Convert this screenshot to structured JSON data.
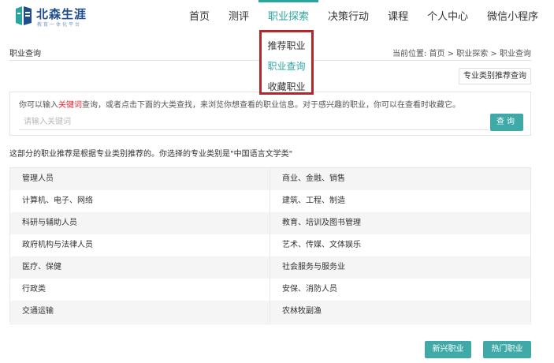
{
  "brand": {
    "name": "北森生涯",
    "tagline": "教育一体化平台",
    "colors": {
      "primary": "#2aa6a0",
      "button": "#3ea9a6",
      "highlight": "#b3262a",
      "keyword": "#e3262e",
      "logo": "#1f4e8a"
    }
  },
  "nav": {
    "items": [
      {
        "label": "首页"
      },
      {
        "label": "测评"
      },
      {
        "label": "职业探索"
      },
      {
        "label": "决策行动"
      },
      {
        "label": "课程"
      },
      {
        "label": "个人中心"
      },
      {
        "label": "微信小程序"
      }
    ],
    "active": "职业探索"
  },
  "dropdown": {
    "items": [
      {
        "label": "推荐职业"
      },
      {
        "label": "职业查询"
      },
      {
        "label": "收藏职业"
      }
    ]
  },
  "page": {
    "label": "职业查询",
    "breadcrumb": "当前位置:   首页 > 职业探索 > 职业查询",
    "recommend_button": "专业类别推荐查询"
  },
  "search": {
    "hint_before": "你可以输入",
    "hint_keyword": "关键词",
    "hint_after": "查询，或者点击下面的大类查找，来浏览你想查看的职业信息。对于感兴趣的职业，你可以在查看时收藏它。",
    "placeholder": "请输入关键词",
    "button": "查询"
  },
  "intro": "这部分的职业推荐是根据专业类别推荐的。你选择的专业类别是\"中国语言文学类\"",
  "categories": [
    [
      "管理人员",
      "商业、金融、销售"
    ],
    [
      "计算机、电子、网络",
      "建筑、工程、制造"
    ],
    [
      "科研与辅助人员",
      "教育、培训及图书管理"
    ],
    [
      "政府机构与法律人员",
      "艺术、传媒、文体娱乐"
    ],
    [
      "医疗、保健",
      "社会服务与服务业"
    ],
    [
      "行政类",
      "安保、消防人员"
    ],
    [
      "交通运输",
      "农林牧副渔"
    ]
  ],
  "footer_buttons": {
    "new": "新兴职业",
    "hot": "热门职业"
  }
}
